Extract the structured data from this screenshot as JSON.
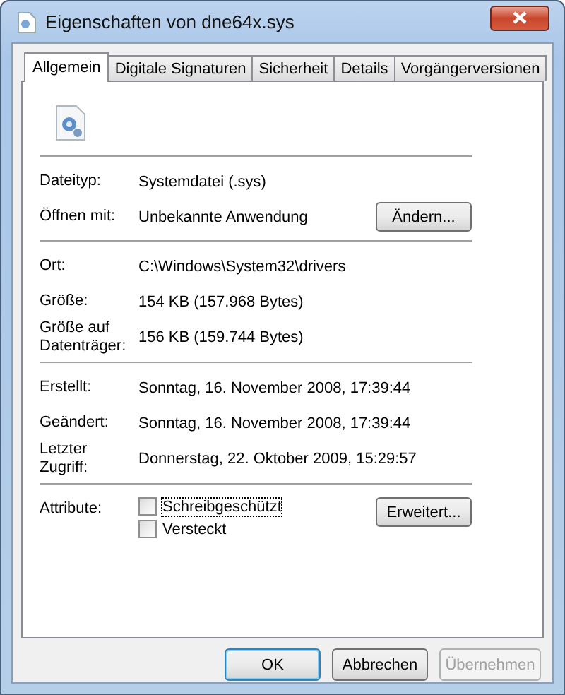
{
  "window": {
    "title": "Eigenschaften von dne64x.sys"
  },
  "tabs": [
    {
      "label": "Allgemein",
      "selected": true
    },
    {
      "label": "Digitale Signaturen",
      "selected": false
    },
    {
      "label": "Sicherheit",
      "selected": false
    },
    {
      "label": "Details",
      "selected": false
    },
    {
      "label": "Vorgängerversionen",
      "selected": false
    }
  ],
  "groups": [
    [
      {
        "label": "Dateityp:",
        "value": "Systemdatei (.sys)"
      },
      {
        "label": "Öffnen mit:",
        "value": "Unbekannte Anwendung",
        "button": "Ändern..."
      }
    ],
    [
      {
        "label": "Ort:",
        "value": "C:\\Windows\\System32\\drivers"
      },
      {
        "label": "Größe:",
        "value": "154 KB (157.968 Bytes)"
      },
      {
        "label": "Größe auf Datenträger:",
        "value": "156 KB (159.744 Bytes)"
      }
    ],
    [
      {
        "label": "Erstellt:",
        "value": "Sonntag, 16. November 2008, 17:39:44"
      },
      {
        "label": "Geändert:",
        "value": "Sonntag, 16. November 2008, 17:39:44"
      },
      {
        "label": "Letzter Zugriff:",
        "value": "Donnerstag, 22. Oktober 2009, 15:29:57"
      }
    ]
  ],
  "attributes": {
    "label": "Attribute:",
    "checkboxes": [
      {
        "label": "Schreibgeschützt",
        "checked": false
      },
      {
        "label": "Versteckt",
        "checked": false
      }
    ],
    "button": "Erweitert..."
  },
  "buttons": [
    {
      "label": "OK",
      "default": true,
      "disabled": false
    },
    {
      "label": "Abbrechen",
      "default": false,
      "disabled": false
    },
    {
      "label": "Übernehmen",
      "default": false,
      "disabled": true
    }
  ]
}
